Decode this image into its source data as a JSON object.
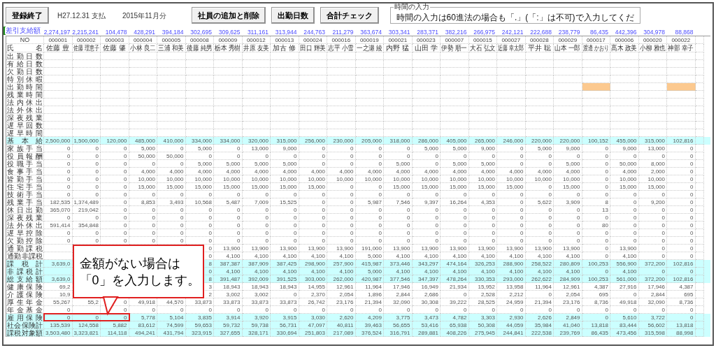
{
  "header": {
    "finish_button": "登録終了",
    "pay_date": "H27.12.31 支払",
    "period": "2015年11月分",
    "buttons": [
      "社員の追加と削除",
      "出勤日数",
      "合計チェック"
    ],
    "note": {
      "legend": "時間の入力",
      "text": "時間の入力は60進法の場合も「.」(「:」は不可)で入力してくだ"
    }
  },
  "summary": {
    "label": "差引支給額",
    "values": [
      "2,274,197",
      "2,215,241",
      "104,478",
      "428,291",
      "394,184",
      "302,695",
      "309,625",
      "311,161",
      "313,944",
      "244,763",
      "211,279",
      "363,674",
      "303,341",
      "283,371",
      "382,216",
      "266,975",
      "242,121",
      "222,688",
      "238,779",
      "86,435",
      "442,396",
      "304,978",
      "88,868"
    ]
  },
  "table": {
    "no_label": "NO",
    "name_label": "氏名",
    "employees": [
      {
        "no": "000001",
        "name": "佐藤 豊"
      },
      {
        "no": "000002",
        "name": "佐藤 理恵子"
      },
      {
        "no": "000003",
        "name": "佐藤 肇"
      },
      {
        "no": "000004",
        "name": "小林 良二"
      },
      {
        "no": "000005",
        "name": "三浦 和美"
      },
      {
        "no": "000008",
        "name": "後藤 純男"
      },
      {
        "no": "000009",
        "name": "栃本 秀樹"
      },
      {
        "no": "000012",
        "name": "井原 友美"
      },
      {
        "no": "000013",
        "name": "加古 修"
      },
      {
        "no": "000024",
        "name": "田口 輝美"
      },
      {
        "no": "000016",
        "name": "志平 小雪"
      },
      {
        "no": "000019",
        "name": "一之瀬 綾"
      },
      {
        "no": "000021",
        "name": "内野 猛"
      },
      {
        "no": "000023",
        "name": "山田 学"
      },
      {
        "no": "000007",
        "name": "伊勢 順一"
      },
      {
        "no": "000015",
        "name": "大石 弘文"
      },
      {
        "no": "000027",
        "name": "近藤 幸太郎"
      },
      {
        "no": "000028",
        "name": "平井 聡"
      },
      {
        "no": "000029",
        "name": "山本 一郎"
      },
      {
        "no": "000017",
        "name": "渡邊 かおり"
      },
      {
        "no": "000006",
        "name": "髙木 政美"
      },
      {
        "no": "000020",
        "name": "小柳 雅也"
      },
      {
        "no": "000022",
        "name": "神部 幸子"
      }
    ],
    "rows": [
      {
        "label": "出勤日数",
        "highlight": false
      },
      {
        "label": "有給日数",
        "highlight": false
      },
      {
        "label": "欠勤日数",
        "highlight": false
      },
      {
        "label": "特別休暇",
        "highlight": false
      },
      {
        "label": "出勤時間",
        "highlight": false,
        "highlighted_cells": [
          false,
          false,
          false,
          false,
          false,
          false,
          false,
          false,
          false,
          false,
          false,
          false,
          false,
          false,
          false,
          false,
          false,
          false,
          false,
          true,
          false,
          false,
          true
        ]
      },
      {
        "label": "残業時間",
        "highlight": false
      },
      {
        "label": "法内休出",
        "highlight": false
      },
      {
        "label": "法外休出",
        "highlight": false
      },
      {
        "label": "深夜残業",
        "highlight": false
      },
      {
        "label": "遅早回数",
        "highlight": false
      },
      {
        "label": "遅早時間",
        "highlight": false
      },
      {
        "label": "基本給",
        "highlight": true,
        "values": [
          "2,500,000",
          "1,500,000",
          "120,000",
          "485,000",
          "410,000",
          "334,000",
          "334,000",
          "320,000",
          "315,000",
          "256,000",
          "230,000",
          "205,000",
          "318,000",
          "286,000",
          "405,000",
          "265,000",
          "246,000",
          "220,000",
          "220,000",
          "100,152",
          "455,000",
          "315,000",
          "102,816"
        ]
      },
      {
        "label": "家族手当",
        "highlight": false,
        "values": [
          "0",
          "0",
          "0",
          "5,000",
          "0",
          "5,000",
          "0",
          "13,000",
          "9,000",
          "0",
          "0",
          "0",
          "0",
          "5,000",
          "5,000",
          "9,000",
          "0",
          "5,000",
          "9,000",
          "0",
          "9,000",
          "13,000",
          "0"
        ]
      },
      {
        "label": "役員報酬",
        "highlight": false,
        "values": [
          "0",
          "0",
          "0",
          "50,000",
          "50,000",
          "0",
          "0",
          "0",
          "0",
          "0",
          "0",
          "0",
          "0",
          "0",
          "0",
          "0",
          "0",
          "0",
          "0",
          "0",
          "0",
          "0",
          "0"
        ]
      },
      {
        "label": "役職手当",
        "highlight": false,
        "values": [
          "0",
          "0",
          "0",
          "0",
          "0",
          "5,000",
          "5,000",
          "5,000",
          "5,000",
          "0",
          "0",
          "0",
          "5,000",
          "0",
          "5,000",
          "5,000",
          "0",
          "0",
          "5,000",
          "0",
          "50,000",
          "8,000",
          "0"
        ]
      },
      {
        "label": "食事手当",
        "highlight": false,
        "values": [
          "0",
          "0",
          "0",
          "4,000",
          "4,000",
          "4,000",
          "4,000",
          "4,000",
          "4,000",
          "4,000",
          "4,000",
          "4,000",
          "4,000",
          "4,000",
          "4,000",
          "4,000",
          "4,000",
          "4,000",
          "4,000",
          "0",
          "4,000",
          "2,000",
          "0"
        ]
      },
      {
        "label": "皆勤手当",
        "highlight": false,
        "values": [
          "0",
          "0",
          "0",
          "10,000",
          "10,000",
          "10,000",
          "10,000",
          "10,000",
          "10,000",
          "10,000",
          "10,000",
          "10,000",
          "10,000",
          "10,000",
          "10,000",
          "10,000",
          "10,000",
          "10,000",
          "10,000",
          "0",
          "10,000",
          "10,000",
          "0"
        ]
      },
      {
        "label": "住宅手当",
        "highlight": false,
        "values": [
          "0",
          "0",
          "0",
          "15,000",
          "15,000",
          "15,000",
          "15,000",
          "15,000",
          "15,000",
          "15,000",
          "0",
          "0",
          "15,000",
          "15,000",
          "15,000",
          "15,000",
          "15,000",
          "0",
          "15,000",
          "0",
          "15,000",
          "15,000",
          "0"
        ]
      },
      {
        "label": "技術手当",
        "highlight": false,
        "values": [
          "0",
          "0",
          "0",
          "0",
          "0",
          "0",
          "0",
          "0",
          "0",
          "0",
          "0",
          "0",
          "0",
          "0",
          "0",
          "0",
          "0",
          "0",
          "0",
          "0",
          "0",
          "0",
          "0"
        ]
      },
      {
        "label": "残業手当",
        "highlight": false,
        "values": [
          "182,535",
          "1,374,489",
          "0",
          "8,853",
          "3,493",
          "10,568",
          "5,487",
          "7,009",
          "15,525",
          "0",
          "0",
          "5,987",
          "7,546",
          "9,397",
          "16,264",
          "4,353",
          "0",
          "5,622",
          "3,909",
          "8",
          "0",
          "9,200",
          "0"
        ]
      },
      {
        "label": "休日出勤",
        "highlight": false,
        "values": [
          "365,070",
          "219,042",
          "0",
          "0",
          "0",
          "0",
          "0",
          "0",
          "0",
          "0",
          "0",
          "0",
          "0",
          "0",
          "0",
          "0",
          "0",
          "0",
          "0",
          "13",
          "0",
          "0",
          "0"
        ]
      },
      {
        "label": "深夜残業",
        "highlight": false,
        "values": [
          "0",
          "0",
          "0",
          "0",
          "0",
          "0",
          "0",
          "0",
          "0",
          "0",
          "0",
          "0",
          "0",
          "0",
          "0",
          "0",
          "0",
          "0",
          "0",
          "0",
          "0",
          "0",
          "0"
        ]
      },
      {
        "label": "法外休出",
        "highlight": false,
        "values": [
          "591,414",
          "354,848",
          "0",
          "0",
          "0",
          "0",
          "0",
          "0",
          "0",
          "0",
          "0",
          "0",
          "0",
          "0",
          "0",
          "0",
          "0",
          "0",
          "0",
          "80",
          "0",
          "0",
          "0"
        ]
      },
      {
        "label": "遅早控除",
        "highlight": false,
        "values": [
          "0",
          "0",
          "0",
          "0",
          "0",
          "0",
          "0",
          "0",
          "0",
          "0",
          "0",
          "0",
          "0",
          "0",
          "0",
          "0",
          "0",
          "0",
          "0",
          "0",
          "0",
          "0",
          "0"
        ]
      },
      {
        "label": "欠勤控除",
        "highlight": false,
        "values": [
          "0",
          "0",
          "0",
          "0",
          "0",
          "0",
          "0",
          "0",
          "0",
          "0",
          "0",
          "0",
          "0",
          "0",
          "0",
          "0",
          "0",
          "0",
          "0",
          "0",
          "0",
          "0",
          "0"
        ]
      },
      {
        "label": "通勤課税",
        "highlight": false,
        "values": [
          "0",
          "13,900",
          "13,900",
          "13,900",
          "13,900",
          "13,900",
          "191,000",
          "13,900",
          "13,900",
          "13,900",
          "13,900",
          "13,900",
          "13,900",
          "13,900",
          "0",
          "13,900",
          "0",
          "0"
        ]
      },
      {
        "label": "通勤非課税",
        "highlight": false,
        "values": [
          "0",
          "4,100",
          "4,100",
          "4,100",
          "4,100",
          "4,100",
          "5,000",
          "4,100",
          "4,100",
          "4,100",
          "4,100",
          "4,100",
          "4,100",
          "4,100",
          "0",
          "4,100",
          "0",
          "0"
        ]
      },
      {
        "label": "課税計",
        "highlight": true,
        "leading_values": [
          "3,639,0"
        ],
        "values": [
          "8",
          "387,387",
          "387,909",
          "387,425",
          "298,900",
          "257,900",
          "415,987",
          "373,446",
          "343,297",
          "474,164",
          "326,253",
          "288,900",
          "258,522",
          "280,809",
          "100,253",
          "556,900",
          "372,200",
          "102,816"
        ]
      },
      {
        "label": "非課税計",
        "highlight": true,
        "values": [
          "0",
          "4,100",
          "4,100",
          "4,100",
          "4,100",
          "4,100",
          "5,000",
          "4,100",
          "4,100",
          "4,100",
          "4,100",
          "4,100",
          "4,100",
          "4,100",
          "0",
          "4,100",
          "0",
          "0"
        ]
      },
      {
        "label": "総支給額",
        "highlight": true,
        "leading_values": [
          "3,639,0"
        ],
        "values": [
          "8",
          "391,487",
          "392,009",
          "391,525",
          "303,000",
          "262,000",
          "420,987",
          "377,546",
          "347,397",
          "478,264",
          "330,353",
          "293,000",
          "262,622",
          "284,909",
          "100,253",
          "561,000",
          "372,200",
          "102,816"
        ]
      },
      {
        "label": "健康保険",
        "highlight": false,
        "leading_values": [
          "69,2"
        ],
        "values": [
          "3",
          "18,943",
          "18,943",
          "18,943",
          "14,955",
          "12,961",
          "11,964",
          "17,946",
          "16,949",
          "21,934",
          "15,952",
          "13,958",
          "11,964",
          "12,961",
          "4,387",
          "27,916",
          "17,946",
          "4,387"
        ]
      },
      {
        "label": "介護保険",
        "highlight": false,
        "leading_values": [
          "10,9"
        ],
        "values": [
          "2",
          "3,002",
          "3,002",
          "0",
          "2,370",
          "2,054",
          "1,896",
          "2,844",
          "2,686",
          "0",
          "2,528",
          "2,212",
          "0",
          "2,054",
          "695",
          "0",
          "2,844",
          "695"
        ]
      },
      {
        "label": "厚生年金",
        "highlight": false,
        "values": [
          "55,267",
          "55,2",
          "0",
          "49,918",
          "44,570",
          "33,873",
          "33,873",
          "33,873",
          "33,873",
          "26,742",
          "23,176",
          "21,394",
          "32,090",
          "30,308",
          "39,222",
          "28,525",
          "24,959",
          "21,394",
          "23,176",
          "8,736",
          "49,918",
          "32,090",
          "8,736"
        ]
      },
      {
        "label": "年金基金",
        "highlight": false,
        "leading_values": [
          "0"
        ],
        "values": [
          "0",
          "0",
          "0",
          "0",
          "0",
          "0",
          "0",
          "0",
          "0",
          "0",
          "0",
          "0",
          "0",
          "0",
          "0",
          "0",
          "0",
          "0",
          "0",
          "0",
          "0"
        ]
      },
      {
        "label": "雇用保険",
        "highlight": true,
        "values": [
          "0",
          "0",
          "0",
          "5,778",
          "5,104",
          "3,835",
          "3,914",
          "3,920",
          "3,915",
          "3,030",
          "2,620",
          "4,209",
          "3,775",
          "3,473",
          "4,782",
          "3,303",
          "2,930",
          "2,626",
          "2,849",
          "0",
          "5,610",
          "3,722",
          "0"
        ]
      },
      {
        "label": "社会保険計",
        "highlight": true,
        "values": [
          "135,539",
          "124,558",
          "5,882",
          "83,612",
          "74,599",
          "59,653",
          "59,732",
          "59,738",
          "56,731",
          "47,097",
          "40,811",
          "39,463",
          "56,655",
          "53,416",
          "65,938",
          "50,308",
          "44,059",
          "35,984",
          "41,040",
          "13,818",
          "83,444",
          "56,602",
          "13,818"
        ]
      },
      {
        "label": "課税対象額",
        "highlight": true,
        "values": [
          "3,503,480",
          "3,323,821",
          "114,118",
          "494,241",
          "431,794",
          "323,915",
          "327,655",
          "328,171",
          "330,694",
          "251,803",
          "217,089",
          "376,524",
          "316,791",
          "289,881",
          "408,226",
          "275,945",
          "244,841",
          "222,538",
          "239,769",
          "86,435",
          "473,456",
          "315,598",
          "88,998"
        ]
      }
    ]
  },
  "callout": {
    "lines": [
      "金額がない場合は",
      "「0」を入力します。"
    ]
  }
}
